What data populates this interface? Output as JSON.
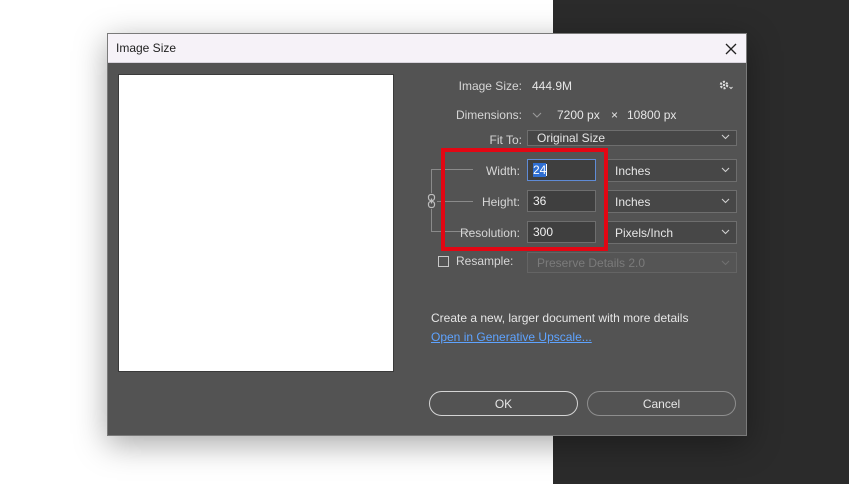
{
  "dialog": {
    "title": "Image Size",
    "image_size_label": "Image Size:",
    "image_size_value": "444.9M",
    "dimensions_label": "Dimensions:",
    "dim_width": "7200 px",
    "dim_times": "×",
    "dim_height": "10800 px",
    "fit_to_label": "Fit To:",
    "fit_to_value": "Original Size",
    "width_label": "Width:",
    "width_value": "24",
    "width_unit": "Inches",
    "height_label": "Height:",
    "height_value": "36",
    "height_unit": "Inches",
    "resolution_label": "Resolution:",
    "resolution_value": "300",
    "resolution_unit": "Pixels/Inch",
    "resample_label": "Resample:",
    "resample_checked": false,
    "resample_method": "Preserve Details 2.0",
    "info_text": "Create a new, larger document with more details",
    "upscale_link": "Open in Generative Upscale...",
    "ok_label": "OK",
    "cancel_label": "Cancel"
  },
  "icons": {
    "close": "close-icon",
    "settings": "gear-icon",
    "constrain": "chain-link-icon",
    "dropdown": "chevron-down-icon"
  },
  "colors": {
    "dialog_bg": "#535353",
    "titlebar_bg": "#f6f2f8",
    "highlight_box": "#e30613",
    "link": "#5ea3ff",
    "selection": "#2f6fd3"
  }
}
